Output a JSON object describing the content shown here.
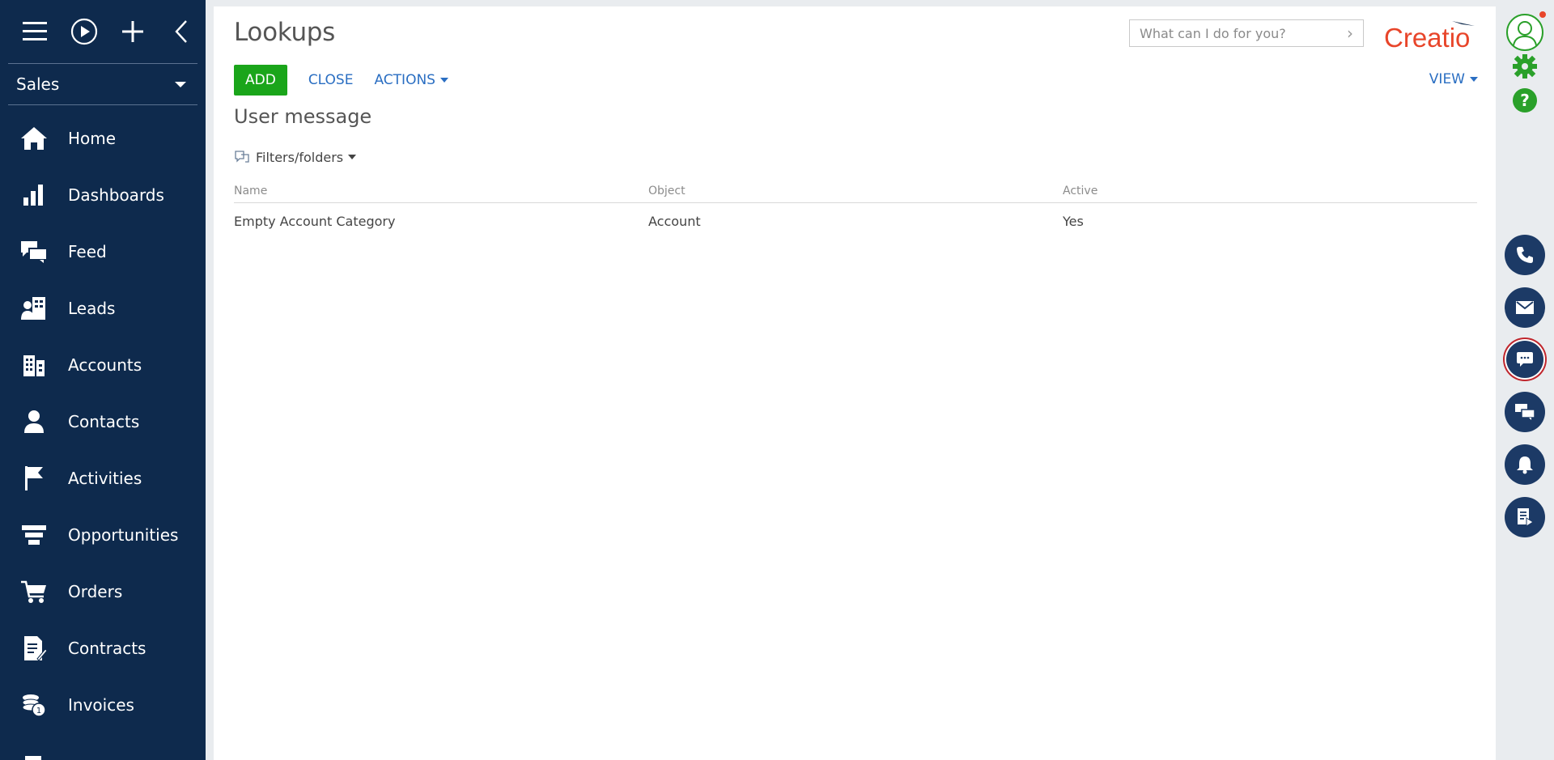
{
  "workspace": {
    "label": "Sales"
  },
  "sidebar": {
    "items": [
      {
        "label": "Home",
        "icon": "home-icon"
      },
      {
        "label": "Dashboards",
        "icon": "dashboards-icon"
      },
      {
        "label": "Feed",
        "icon": "feed-icon"
      },
      {
        "label": "Leads",
        "icon": "leads-icon"
      },
      {
        "label": "Accounts",
        "icon": "accounts-icon"
      },
      {
        "label": "Contacts",
        "icon": "contacts-icon"
      },
      {
        "label": "Activities",
        "icon": "activities-icon"
      },
      {
        "label": "Opportunities",
        "icon": "opportunities-icon"
      },
      {
        "label": "Orders",
        "icon": "orders-icon"
      },
      {
        "label": "Contracts",
        "icon": "contracts-icon"
      },
      {
        "label": "Invoices",
        "icon": "invoices-icon"
      }
    ]
  },
  "header": {
    "title": "Lookups",
    "search_placeholder": "What can I do for you?",
    "logo_text": "Creatio"
  },
  "toolbar": {
    "add_label": "ADD",
    "close_label": "CLOSE",
    "actions_label": "ACTIONS",
    "view_label": "VIEW"
  },
  "section": {
    "subtitle": "User message",
    "filters_label": "Filters/folders"
  },
  "table": {
    "columns": [
      "Name",
      "Object",
      "Active"
    ],
    "rows": [
      [
        "Empty Account Category",
        "Account",
        "Yes"
      ]
    ]
  },
  "colors": {
    "sidebar_bg": "#0e2a4d",
    "accent_green": "#1aa51a",
    "link_blue": "#2a6ec2",
    "logo_red": "#e8452a",
    "circle_btn": "#1c3a66"
  }
}
